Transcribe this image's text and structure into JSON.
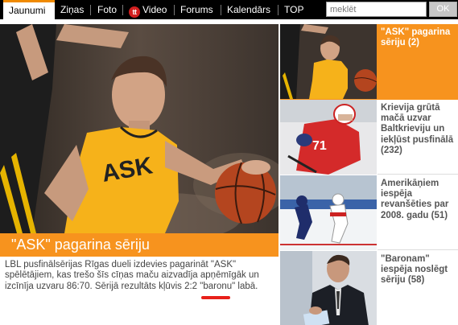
{
  "nav": {
    "tabs": [
      {
        "label": "Jaunumi",
        "active": true
      },
      {
        "label": "Ziņas"
      },
      {
        "label": "Foto"
      },
      {
        "label": "Video",
        "logo": "tt"
      },
      {
        "label": "Forums"
      },
      {
        "label": "Kalendārs"
      },
      {
        "label": "TOP"
      }
    ],
    "search_placeholder": "meklēt",
    "search_button": "OK"
  },
  "main_story": {
    "title": "\"ASK\" pagarina sēriju",
    "lead": "LBL pusfinālsērijas Rīgas dueli izdevies pagarināt \"ASK\" spēlētājiem, kas trešo šīs cīņas maču aizvadīja apņēmīgāk un izcīnīja uzvaru 86:70. Sērijā rezultāts kļūvis 2:2 \"baronu\" labā.",
    "jersey_text": "ASK",
    "image": "basketball-player-dribbling-photo"
  },
  "side_stories": [
    {
      "title": "\"ASK\" pagarina sēriju (2)",
      "highlighted": true,
      "image": "basketball-player-photo"
    },
    {
      "title": "Krievija grūtā mačā uzvar Baltkrieviju un iekļūst pusfinālā (232)",
      "image": "hockey-player-photo"
    },
    {
      "title": "Amerikāņiem iespēja revanšēties par 2008. gadu (51)",
      "image": "hockey-game-photo"
    },
    {
      "title": "\"Baronam\" iespēja noslēgt sēriju (58)",
      "image": "coach-photo"
    }
  ],
  "colors": {
    "accent": "#f7931e",
    "nav_bg": "#000000",
    "tab_indicator": "#f08a00",
    "tt_logo": "#d21f1f",
    "text": "#444444",
    "highlight_underline": "#e8201a"
  }
}
